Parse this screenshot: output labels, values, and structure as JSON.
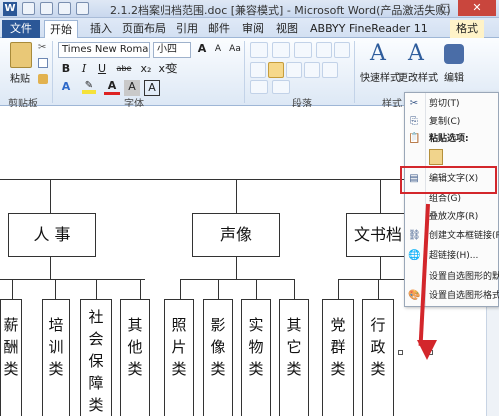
{
  "title_bar": {
    "title": "2.1.2档案归档范围.doc [兼容模式] - Microsoft Word(产品激活失败)",
    "app_badge": "W",
    "min": "–",
    "max": "□",
    "close": "✕"
  },
  "tabs": [
    "文件",
    "开始",
    "插入",
    "页面布局",
    "引用",
    "邮件",
    "审阅",
    "视图",
    "ABBYY FineReader 11",
    "格式"
  ],
  "ribbon": {
    "paste_label": "粘贴",
    "clipboard_group": "剪贴板",
    "font_name": "Times New Roman",
    "font_size": "小四",
    "font_group": "字体",
    "paragraph_group": "段落",
    "quick_styles_label": "快速样式",
    "change_styles_label": "更改样式",
    "styles_group": "样式",
    "edit_label": "编辑",
    "bold": "B",
    "italic": "I",
    "underline": "U",
    "abc": "abe",
    "sub": "x₂",
    "sup": "x²",
    "font_color": "A",
    "grow": "A",
    "shrink": "A",
    "aa": "Aa",
    "wen": "变"
  },
  "doc": {
    "level1": [
      "人 事",
      "声像",
      "文书档"
    ],
    "level2": [
      {
        "text": "薪酬类"
      },
      {
        "text": "培训类"
      },
      {
        "text": "社会保障类"
      },
      {
        "text": "其他类"
      },
      {
        "text": "照片类"
      },
      {
        "text": "影像类"
      },
      {
        "text": "实物类"
      },
      {
        "text": "其它类"
      },
      {
        "text": "党群类"
      },
      {
        "text": "行政类"
      }
    ]
  },
  "context_menu": {
    "items": [
      {
        "label": "剪切(T)",
        "icon": "scissors-icon",
        "glyph": "✂"
      },
      {
        "label": "复制(C)",
        "icon": "copy-icon",
        "glyph": "⎘"
      },
      {
        "label": "粘贴选项:",
        "icon": "paste-icon",
        "glyph": "📋"
      },
      {
        "label": "编辑文字(X)",
        "icon": "edit-text-icon",
        "glyph": "▤"
      },
      {
        "label": "组合(G)",
        "icon": "group-icon",
        "glyph": ""
      },
      {
        "label": "叠放次序(R)",
        "icon": "order-icon",
        "glyph": ""
      },
      {
        "label": "创建文本框链接(R)",
        "icon": "link-icon",
        "glyph": "⛓"
      },
      {
        "label": "超链接(H)...",
        "icon": "hyperlink-icon",
        "glyph": "🌐"
      },
      {
        "label": "设置自选图形的默认",
        "icon": "default-shape-icon",
        "glyph": ""
      },
      {
        "label": "设置自选图形格式",
        "icon": "format-shape-icon",
        "glyph": "🎨"
      }
    ]
  },
  "colors": {
    "accent_red": "#d3262b",
    "file_tab": "#2b5797"
  }
}
